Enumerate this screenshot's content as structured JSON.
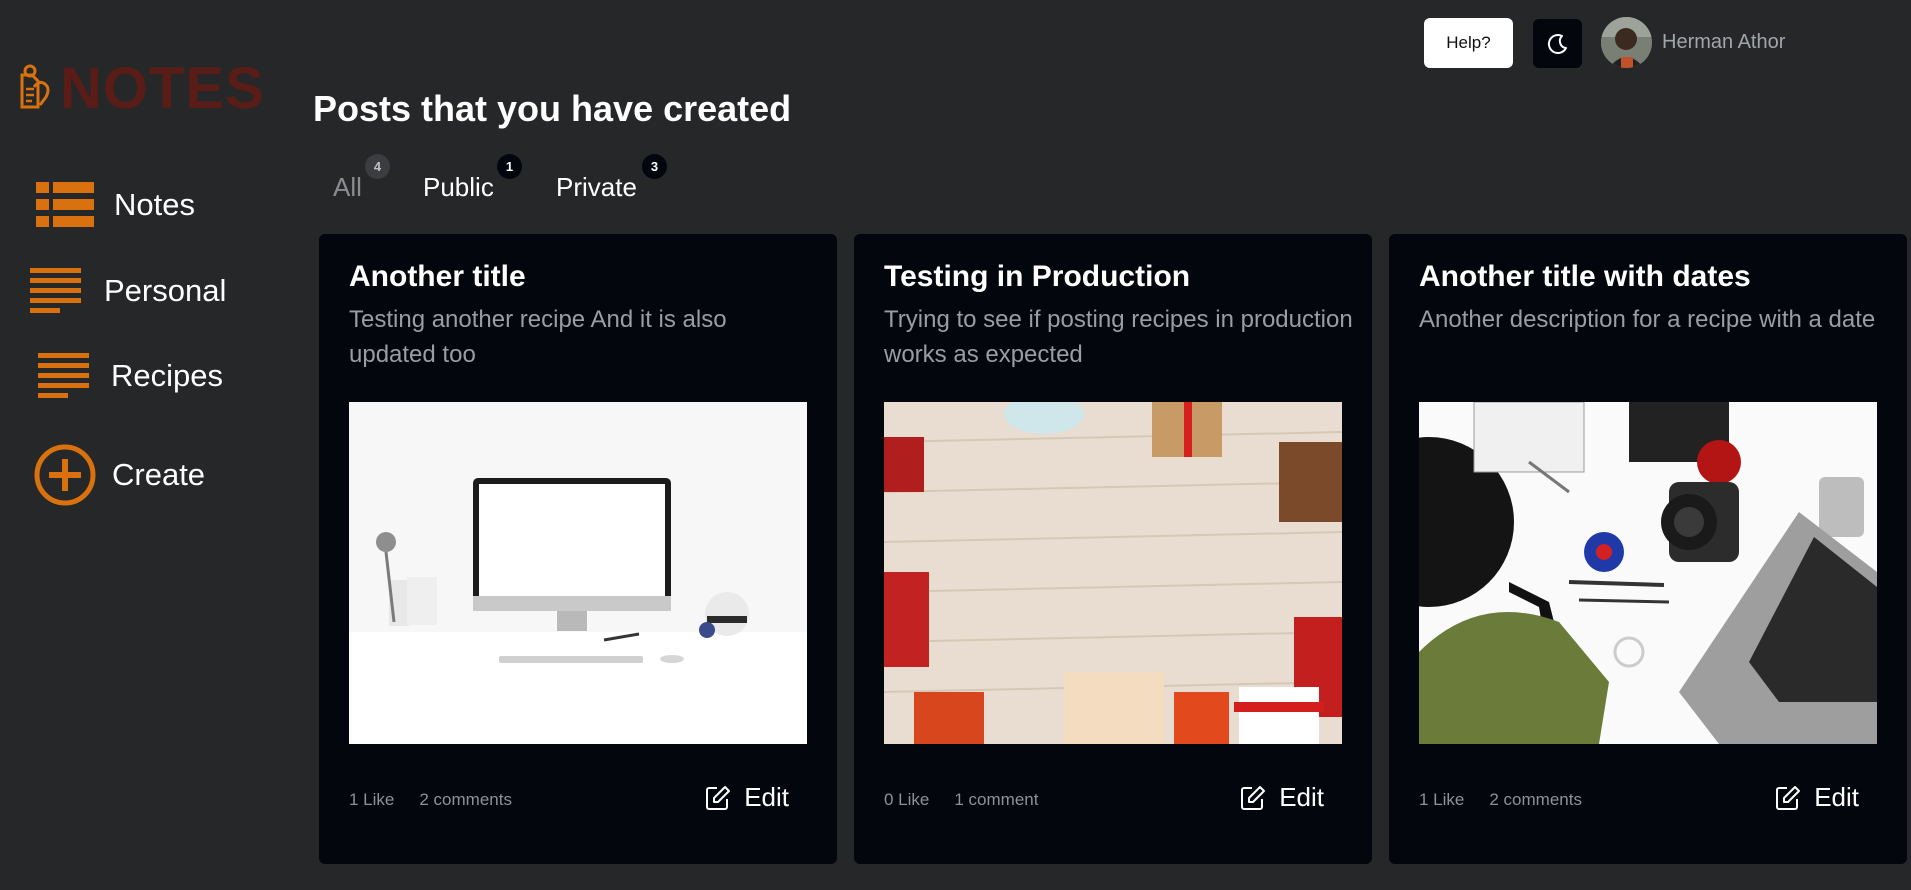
{
  "brand": {
    "logo_text": "NOTES",
    "accent": "#d9720e",
    "logo_text_color": "#5a1c16"
  },
  "sidebar": {
    "items": [
      {
        "label": "Notes",
        "icon": "list-icon"
      },
      {
        "label": "Personal",
        "icon": "lines-icon"
      },
      {
        "label": "Recipes",
        "icon": "lines-icon"
      },
      {
        "label": "Create",
        "icon": "plus-circle-icon"
      }
    ]
  },
  "header": {
    "help_label": "Help?",
    "theme_icon": "moon-icon",
    "user_name": "Herman Athor"
  },
  "main": {
    "title": "Posts that you have created",
    "tabs": [
      {
        "label": "All",
        "count": "4"
      },
      {
        "label": "Public",
        "count": "1"
      },
      {
        "label": "Private",
        "count": "3"
      }
    ],
    "cards": [
      {
        "title": "Another title",
        "description": "Testing another recipe And it is also updated too",
        "image": "desk-computer-photo",
        "likes": "1 Like",
        "comments": "2 comments",
        "edit_label": "Edit"
      },
      {
        "title": "Testing in Production",
        "description": "Trying to see if posting recipes in production works as expected",
        "image": "gift-boxes-on-wood-photo",
        "likes": "0 Like",
        "comments": "1 comment",
        "edit_label": "Edit"
      },
      {
        "title": "Another title with dates",
        "description": "Another description for a recipe with a date",
        "image": "flatlay-camera-laptop-photo",
        "likes": "1 Like",
        "comments": "2 comments",
        "edit_label": "Edit"
      }
    ]
  }
}
